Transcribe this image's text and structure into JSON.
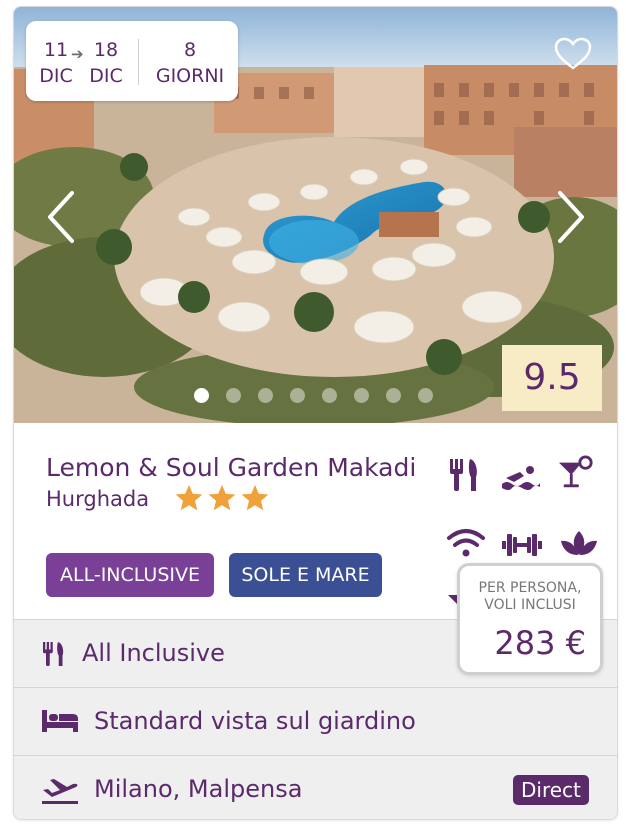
{
  "dates": {
    "start_day": "11",
    "start_month": "DIC",
    "end_day": "18",
    "end_month": "DIC",
    "duration_num": "8",
    "duration_unit": "GIORNI"
  },
  "gallery": {
    "total_images": 8,
    "active_index": 0
  },
  "score": "9.5",
  "hotel": {
    "name": "Lemon & Soul Garden Makadi",
    "city": "Hurghada",
    "stars": 3
  },
  "badges": [
    "ALL-INCLUSIVE",
    "SOLE E MARE"
  ],
  "amenities": [
    "restaurant-icon",
    "swimming-icon",
    "bar-icon",
    "wifi-icon",
    "gym-icon",
    "spa-icon",
    "cocktail-icon"
  ],
  "price": {
    "label": "PER PERSONA, VOLI INCLUSI",
    "value": "283 €"
  },
  "details": {
    "board": "All Inclusive",
    "room": "Standard vista sul giardino",
    "departure": "Milano, Malpensa",
    "flight_type": "Direct"
  },
  "colors": {
    "primary": "#5b2a6b",
    "badge_allinc": "#7a3f96",
    "badge_sun": "#3b4f95",
    "score_bg": "#f7ecc6",
    "star": "#f0a13a"
  }
}
